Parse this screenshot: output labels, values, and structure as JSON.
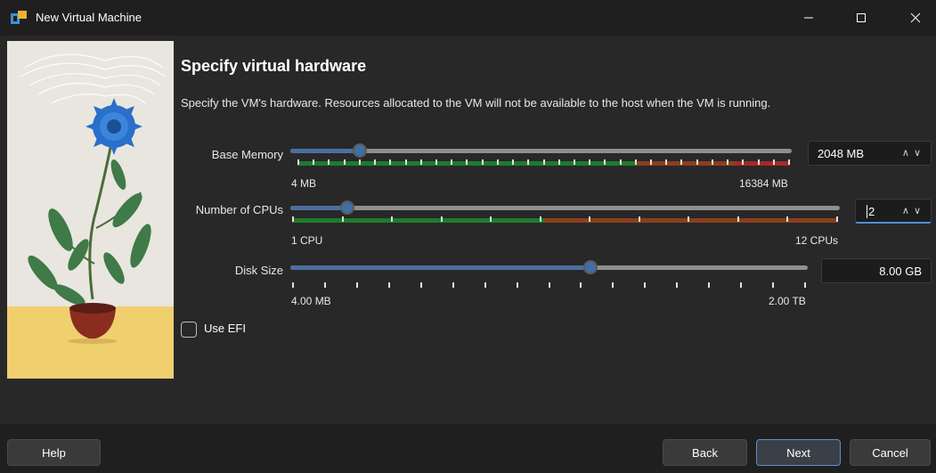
{
  "window": {
    "title": "New Virtual Machine"
  },
  "page": {
    "heading": "Specify virtual hardware",
    "description": "Specify the VM's hardware. Resources allocated to the VM will not be available to the host when the VM is running."
  },
  "memory": {
    "label": "Base Memory",
    "min_label": "4 MB",
    "max_label": "16384 MB",
    "value": "2048 MB",
    "level": 0.125
  },
  "cpus": {
    "label": "Number of CPUs",
    "min_label": "1 CPU",
    "max_label": "12 CPUs",
    "value": "2",
    "level": 0.09
  },
  "disk": {
    "label": "Disk Size",
    "min_label": "4.00 MB",
    "max_label": "2.00 TB",
    "value": "8.00 GB",
    "level": 0.59
  },
  "efi": {
    "label": "Use EFI",
    "checked": false
  },
  "footer": {
    "help": "Help",
    "back": "Back",
    "next": "Next",
    "cancel": "Cancel"
  },
  "colors": {
    "accent": "#4d8fd8",
    "slider_fill": "#4d6f9e",
    "green_zone": "#1f7a2c",
    "orange_zone": "#8a3f1e",
    "red_zone": "#a22a2a"
  },
  "icons": {
    "app": "virtualbox-icon",
    "spinner": "chevron-up-down-icon"
  }
}
